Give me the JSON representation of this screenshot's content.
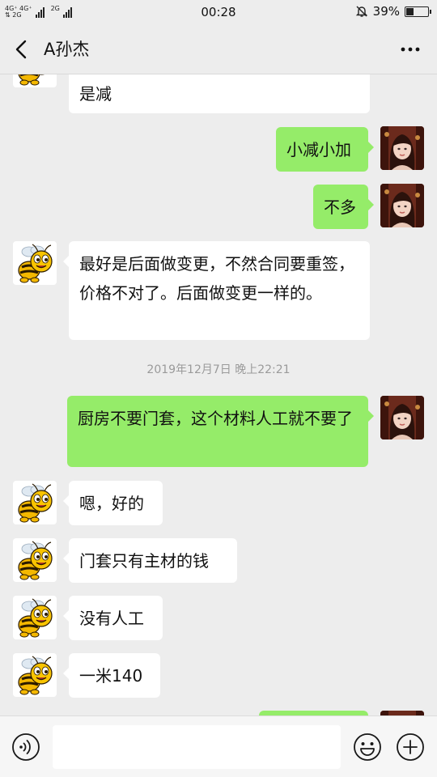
{
  "status_bar": {
    "network_top": "4G⁺ 4G⁺",
    "network_bottom": "⇅ 2G",
    "network_2g": "2G",
    "time": "00:28",
    "battery_text": "39%",
    "battery_level": 0.39,
    "icons": [
      "signal-icon",
      "mute-bell-icon",
      "battery-icon"
    ]
  },
  "header": {
    "title": "A孙杰",
    "back_icon": "chevron-left-icon",
    "more_icon": "more-dots-icon"
  },
  "messages": [
    {
      "side": "in",
      "text": "是减",
      "avatar": "bee"
    },
    {
      "side": "out",
      "text": "小减小加",
      "avatar": "girl"
    },
    {
      "side": "out",
      "text": "不多",
      "avatar": "girl"
    },
    {
      "side": "in",
      "text": "最好是后面做变更，不然合同要重签，价格不对了。后面做变更一样的。",
      "avatar": "bee"
    },
    {
      "timestamp": "2019年12月7日 晚上22:21"
    },
    {
      "side": "out",
      "text": "厨房不要门套，这个材料人工就不要了",
      "avatar": "girl"
    },
    {
      "side": "in",
      "text": "嗯，好的",
      "avatar": "bee"
    },
    {
      "side": "in",
      "text": "门套只有主材的钱",
      "avatar": "bee"
    },
    {
      "side": "in",
      "text": "没有人工",
      "avatar": "bee"
    },
    {
      "side": "in",
      "text": "一米140",
      "avatar": "bee"
    }
  ],
  "input_bar": {
    "placeholder": "",
    "voice_icon": "voice-icon",
    "emoji_icon": "emoji-icon",
    "plus_icon": "plus-icon"
  },
  "colors": {
    "background": "#ededed",
    "outgoing_bubble": "#95ec69",
    "incoming_bubble": "#ffffff"
  }
}
